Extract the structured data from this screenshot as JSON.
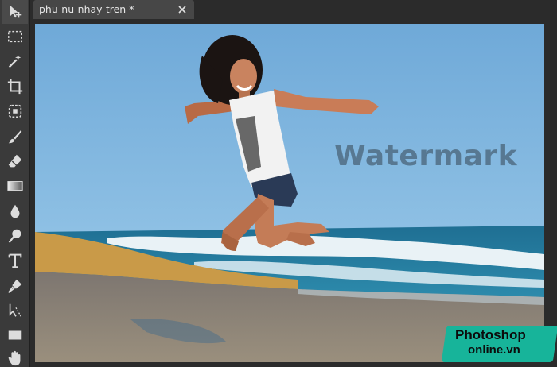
{
  "toolbar": {
    "tools": [
      {
        "name": "move-tool",
        "icon": "move-arrow-icon",
        "active": true
      },
      {
        "name": "marquee-tool",
        "icon": "dashed-rectangle-icon"
      },
      {
        "name": "magic-wand-tool",
        "icon": "magic-wand-icon"
      },
      {
        "name": "crop-tool",
        "icon": "crop-icon"
      },
      {
        "name": "object-select-tool",
        "icon": "dashed-square-icon"
      },
      {
        "name": "brush-tool",
        "icon": "brush-icon"
      },
      {
        "name": "eraser-tool",
        "icon": "eraser-icon"
      },
      {
        "name": "gradient-tool",
        "icon": "gradient-icon"
      },
      {
        "name": "blur-tool",
        "icon": "drop-icon"
      },
      {
        "name": "dodge-tool",
        "icon": "dodge-icon"
      },
      {
        "name": "text-tool",
        "icon": "text-icon",
        "label": "T"
      },
      {
        "name": "pen-tool",
        "icon": "pen-icon"
      },
      {
        "name": "path-select-tool",
        "icon": "path-arrow-icon"
      },
      {
        "name": "shape-tool",
        "icon": "rectangle-icon"
      },
      {
        "name": "hand-tool",
        "icon": "hand-icon"
      }
    ]
  },
  "document_tab": {
    "title": "phu-nu-nhay-tren",
    "modified_marker": "*",
    "close_icon": "close-icon"
  },
  "image_overlay": {
    "watermark_text": "Watermark"
  },
  "logo": {
    "line1": "Photoshop",
    "line2": "online.vn",
    "color": "#17b49a"
  },
  "colors": {
    "toolbar_bg": "#3a3a3a",
    "tab_bg": "#474747",
    "workspace_bg": "#2b2b2b",
    "active_tool_accent": "#4a90e2"
  }
}
